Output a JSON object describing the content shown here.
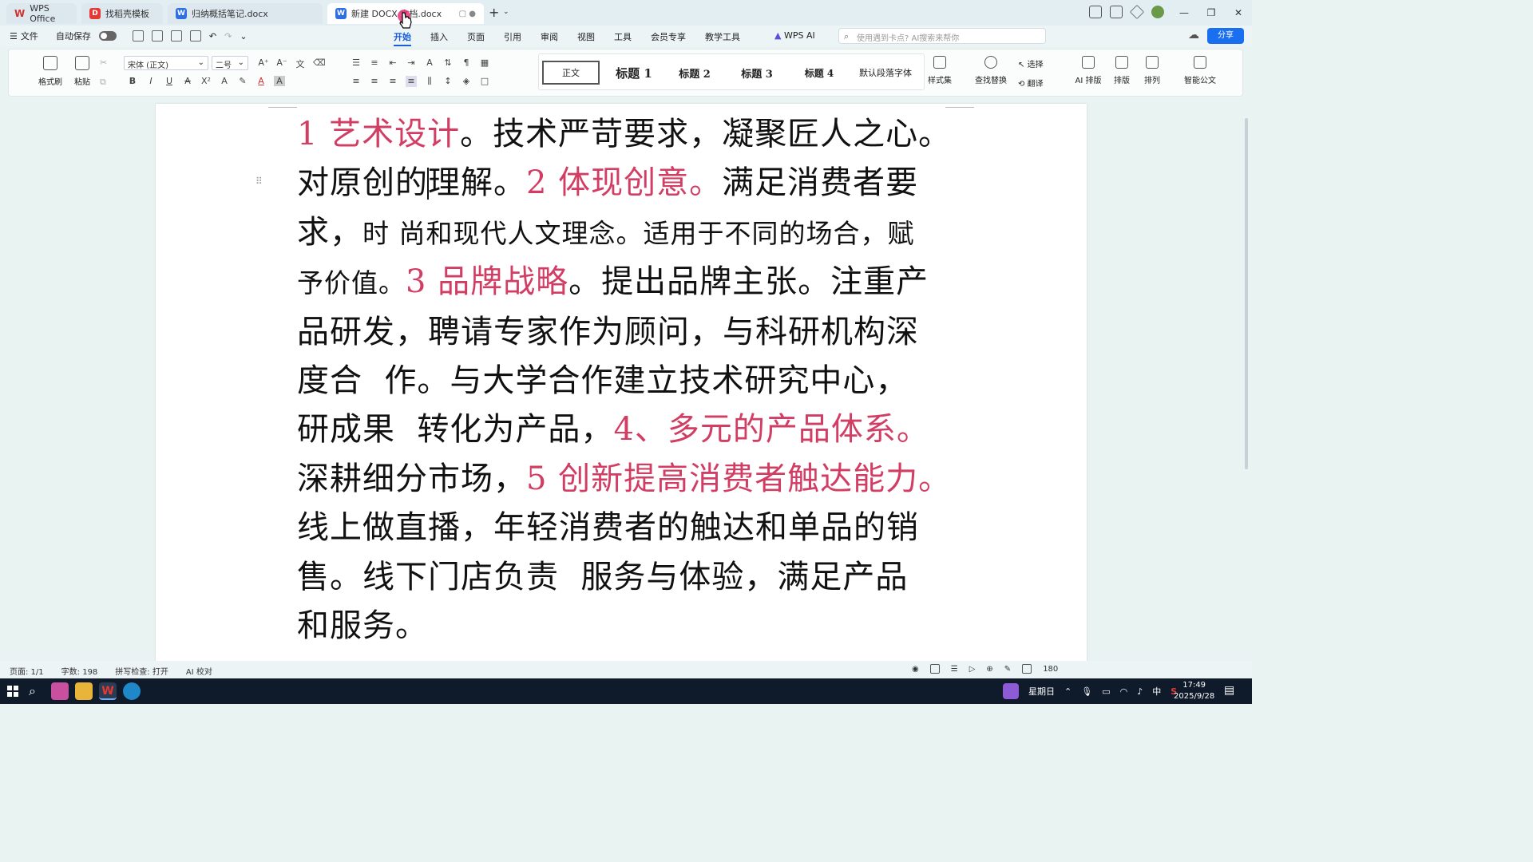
{
  "tabs": [
    {
      "label": "WPS Office",
      "icon": "wps-logo-icon"
    },
    {
      "label": "找稻壳模板",
      "icon": "docer-icon"
    },
    {
      "label": "归纳概括笔记.docx",
      "icon": "word-doc-icon"
    },
    {
      "label": "新建 DOCX 文档.docx",
      "icon": "word-doc-icon"
    }
  ],
  "menubar": {
    "file": "文件",
    "autosave": "自动保存",
    "menus": [
      "开始",
      "插入",
      "页面",
      "引用",
      "审阅",
      "视图",
      "工具",
      "会员专享",
      "教学工具"
    ],
    "wps_ai": "WPS AI",
    "search_placeholder": "使用遇到卡点? AI搜索来帮你",
    "share": "分享"
  },
  "ribbon": {
    "format_painter": "格式刷",
    "paste": "粘贴",
    "font_name": "宋体 (正文)",
    "font_size": "二号",
    "styles": [
      "正文",
      "标题 1",
      "标题 2",
      "标题 3",
      "标题 4",
      "默认段落字体"
    ],
    "style_set": "样式集",
    "find_replace": "查找替换",
    "select": "选择",
    "translate": "翻译",
    "ai_layout": "AI 排版",
    "layout": "排版",
    "arrange": "排列",
    "smart_doc": "智能公文"
  },
  "document": {
    "lines": [
      [
        {
          "t": "1 艺术设计",
          "h": true
        },
        {
          "t": "。技术严苛要求，凝聚匠人之心。"
        }
      ],
      [
        {
          "t": "对原创的"
        },
        {
          "t": "理解。"
        },
        {
          "t": "2 体现创意。",
          "h": true
        },
        {
          "t": "满足消费者要"
        }
      ],
      [
        {
          "t": "求，"
        },
        {
          "t": "时 尚和现代人文理念。适用于不同的场合，赋",
          "s": true
        }
      ],
      [
        {
          "t": "予价值。",
          "s": true
        },
        {
          "t": "3 品牌战略",
          "h": true
        },
        {
          "t": "。提出品牌主张。注重产"
        }
      ],
      [
        {
          "t": "品研发，聘请专家作为顾问，与科研机构深"
        }
      ],
      [
        {
          "t": "度合  作。与大学合作建立技术研究中心，"
        }
      ],
      [
        {
          "t": "研成果  转化为产品，"
        },
        {
          "t": "4、多元的产品体系。",
          "h": true
        }
      ],
      [
        {
          "t": "深耕细分市场，"
        },
        {
          "t": "5 创新提高消费者触达能力。",
          "h": true
        }
      ],
      [
        {
          "t": "线上做直播，年轻消费者的触达和单品的销"
        }
      ],
      [
        {
          "t": "售。线下门店负责  服务与体验，满足产品"
        }
      ],
      [
        {
          "t": "和服务。"
        }
      ]
    ],
    "highlight_color": "#d23d63"
  },
  "statusbar": {
    "page": "页面: 1/1",
    "words": "字数: 198",
    "spell": "拼写检查: 打开",
    "ai_check": "AI 校对",
    "zoom": "180"
  },
  "taskbar": {
    "weekday": "星期日",
    "ime": "中",
    "time": "17:49",
    "date": "2025/9/28"
  }
}
